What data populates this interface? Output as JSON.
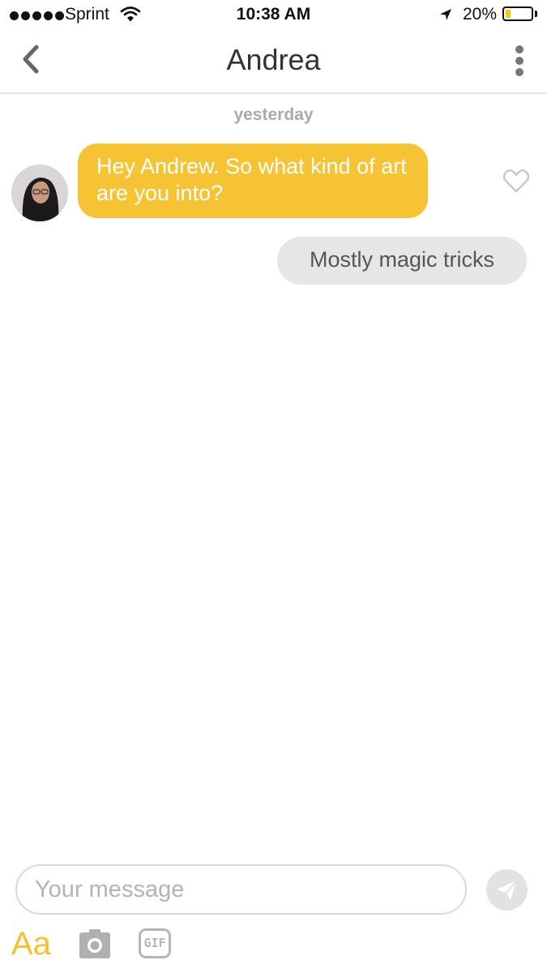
{
  "status_bar": {
    "carrier": "Sprint",
    "time": "10:38 AM",
    "battery_percent": "20%",
    "battery_level": 0.2,
    "signal_icon": "signal-dots-icon",
    "wifi_icon": "wifi-icon",
    "location_icon": "location-arrow-icon",
    "battery_color": "#f5c518"
  },
  "nav": {
    "title": "Andrea",
    "back_icon": "chevron-left-icon",
    "more_icon": "vertical-ellipsis-icon"
  },
  "conversation": {
    "date_label": "yesterday",
    "messages": [
      {
        "direction": "incoming",
        "text": "Hey Andrew. So what kind of art are you into?",
        "bubble_color": "#f6c334"
      },
      {
        "direction": "outgoing",
        "text": "Mostly magic tricks",
        "bubble_color": "#e6e6e6"
      }
    ],
    "like_icon": "heart-outline-icon"
  },
  "composer": {
    "placeholder": "Your message",
    "value": "",
    "send_icon": "paper-plane-icon",
    "text_format_label": "Aa",
    "camera_icon": "camera-icon",
    "gif_label": "GIF",
    "accent_color": "#f5c12e"
  }
}
